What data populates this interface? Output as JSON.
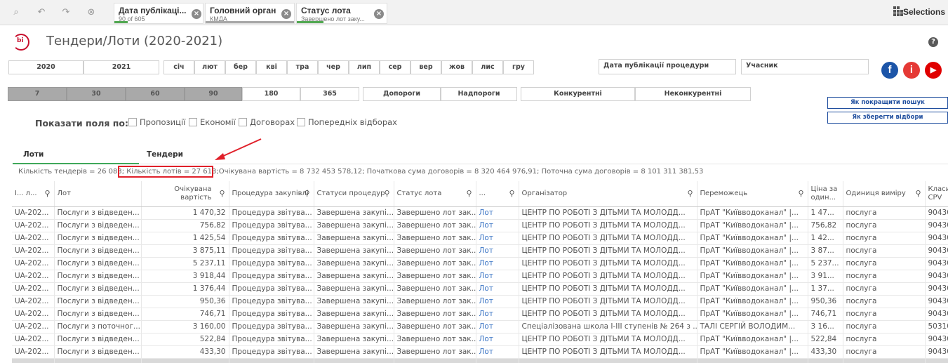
{
  "selections_bar": {
    "chips": [
      {
        "title": "Дата публікаці...",
        "sub": "90 of 605",
        "bar_color": "#52a852",
        "fill": 0.15
      },
      {
        "title": "Головний орган",
        "sub": "КМДА",
        "bar_color": "#a8a8a8",
        "fill": 1.0
      },
      {
        "title": "Статус лота",
        "sub": "Завершено лот заку...",
        "bar_color": "#52a852",
        "fill": 0.3
      }
    ],
    "selections_label": "Selections"
  },
  "header": {
    "logo_text": "bi",
    "title": "Тендери/Лоти (2020-2021)",
    "help": "?"
  },
  "filters": {
    "years": [
      "2020",
      "2021"
    ],
    "months": [
      "січ",
      "лют",
      "бер",
      "кві",
      "тра",
      "чер",
      "лип",
      "сер",
      "вер",
      "жов",
      "лис",
      "гру"
    ],
    "date_field": "Дата публікації процедури",
    "participant_field": "Учасник",
    "days": [
      "7",
      "30",
      "60",
      "90",
      "180",
      "365"
    ],
    "thresholds": [
      "Допороги",
      "Надпороги"
    ],
    "competition": [
      "Конкурентні",
      "Неконкурентні"
    ]
  },
  "social": {
    "facebook": "f",
    "info": "i",
    "youtube": "▶"
  },
  "buttons": {
    "improve_search": "Як покращити пошук",
    "save_filters": "Як зберегти відбори"
  },
  "show_fields": {
    "label": "Показати поля по:",
    "options": [
      "Пропозиції",
      "Економії",
      "Договорах",
      "Попередніх відборах"
    ]
  },
  "tabs": [
    "Лоти",
    "Тендери"
  ],
  "stats": {
    "tenders": "Кількість тендерів = 26 083;",
    "lots": "Кількість лотів = 27 613;",
    "rest": "Очікувана вартість = 8 732 453 578,12; Початкова сума договорів = 8 320 464 976,91; Поточна сума договорів = 8 101 311 381,53"
  },
  "table": {
    "headers": [
      "I... л...",
      "Лот",
      "Очікувана вартість",
      "Процедура закупівлі",
      "Статуси процедур",
      "Статус лота",
      "...",
      "Організатор",
      "Переможець",
      "Ціна за один...",
      "Одиниця виміру",
      "Класиф CPV"
    ],
    "rows": [
      [
        "UA-202...",
        "Послуги з відведен...",
        "1 470,32",
        "Процедура звітува...",
        "Завершена закупі...",
        "Завершено лот зак...",
        "Лот",
        "ЦЕНТР ПО РОБОТІ З ДІТЬМИ ТА МОЛОДД...",
        "ПрАТ \"Київводоканал\" |...",
        "1 47...",
        "послуга",
        "90430("
      ],
      [
        "UA-202...",
        "Послуги з відведен...",
        "756,82",
        "Процедура звітува...",
        "Завершена закупі...",
        "Завершено лот зак...",
        "Лот",
        "ЦЕНТР ПО РОБОТІ З ДІТЬМИ ТА МОЛОДД...",
        "ПрАТ \"Київводоканал\" |...",
        "756,82",
        "послуга",
        "90430("
      ],
      [
        "UA-202...",
        "Послуги з відведен...",
        "1 425,54",
        "Процедура звітува...",
        "Завершена закупі...",
        "Завершено лот зак...",
        "Лот",
        "ЦЕНТР ПО РОБОТІ З ДІТЬМИ ТА МОЛОДД...",
        "ПрАТ \"Київводоканал\" |...",
        "1 42...",
        "послуга",
        "90430("
      ],
      [
        "UA-202...",
        "Послуги з відведен...",
        "3 875,11",
        "Процедура звітува...",
        "Завершена закупі...",
        "Завершено лот зак...",
        "Лот",
        "ЦЕНТР ПО РОБОТІ З ДІТЬМИ ТА МОЛОДД...",
        "ПрАТ \"Київводоканал\" |...",
        "3 87...",
        "послуга",
        "90430("
      ],
      [
        "UA-202...",
        "Послуги з відведен...",
        "5 237,11",
        "Процедура звітува...",
        "Завершена закупі...",
        "Завершено лот зак...",
        "Лот",
        "ЦЕНТР ПО РОБОТІ З ДІТЬМИ ТА МОЛОДД...",
        "ПрАТ \"Київводоканал\" |...",
        "5 237...",
        "послуга",
        "90430("
      ],
      [
        "UA-202...",
        "Послуги з відведен...",
        "3 918,44",
        "Процедура звітува...",
        "Завершена закупі...",
        "Завершено лот зак...",
        "Лот",
        "ЦЕНТР ПО РОБОТІ З ДІТЬМИ ТА МОЛОДД...",
        "ПрАТ \"Київводоканал\" |...",
        "3 91...",
        "послуга",
        "90430("
      ],
      [
        "UA-202...",
        "Послуги з відведен...",
        "1 376,44",
        "Процедура звітува...",
        "Завершена закупі...",
        "Завершено лот зак...",
        "Лот",
        "ЦЕНТР ПО РОБОТІ З ДІТЬМИ ТА МОЛОДД...",
        "ПрАТ \"Київводоканал\" |...",
        "1 37...",
        "послуга",
        "90430("
      ],
      [
        "UA-202...",
        "Послуги з відведен...",
        "950,36",
        "Процедура звітува...",
        "Завершена закупі...",
        "Завершено лот зак...",
        "Лот",
        "ЦЕНТР ПО РОБОТІ З ДІТЬМИ ТА МОЛОДД...",
        "ПрАТ \"Київводоканал\" |...",
        "950,36",
        "послуга",
        "90430("
      ],
      [
        "UA-202...",
        "Послуги з відведен...",
        "746,71",
        "Процедура звітува...",
        "Завершена закупі...",
        "Завершено лот зак...",
        "Лот",
        "ЦЕНТР ПО РОБОТІ З ДІТЬМИ ТА МОЛОДД...",
        "ПрАТ \"Київводоканал\" |...",
        "746,71",
        "послуга",
        "90430("
      ],
      [
        "UA-202...",
        "Послуги з поточног...",
        "3 160,00",
        "Процедура звітува...",
        "Завершена закупі...",
        "Завершено лот зак...",
        "Лот",
        "Спеціалізована школа І-ІІІ ступенів № 264 з ...",
        "ТАЛІ СЕРГІЙ ВОЛОДИМ...",
        "3 16...",
        "послуга",
        "50310("
      ],
      [
        "UA-202...",
        "Послуги з відведен...",
        "522,84",
        "Процедура звітува...",
        "Завершена закупі...",
        "Завершено лот зак...",
        "Лот",
        "ЦЕНТР ПО РОБОТІ З ДІТЬМИ ТА МОЛОДД...",
        "ПрАТ \"Київводоканал\" |...",
        "522,84",
        "послуга",
        "90430("
      ],
      [
        "UA-202...",
        "Послуги з відведен...",
        "433,30",
        "Процедура звітува...",
        "Завершена закупі...",
        "Завершено лот зак...",
        "Лот",
        "ЦЕНТР ПО РОБОТІ З ДІТЬМИ ТА МОЛОДД...",
        "ПрАТ \"Київводоканал\" |...",
        "433,30",
        "послуга",
        "90430("
      ]
    ]
  },
  "colors": {
    "accent_green": "#3fa85a",
    "highlight_red": "#e0202a",
    "link_blue": "#3a74c4"
  }
}
